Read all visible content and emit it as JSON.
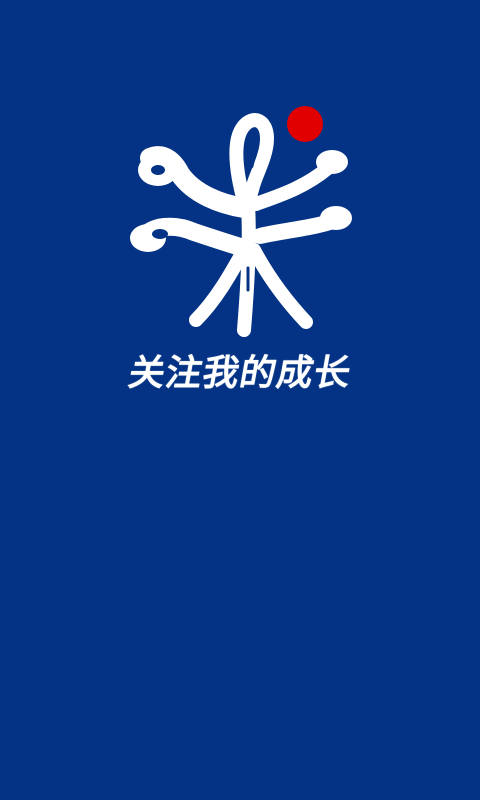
{
  "splash": {
    "slogan": "关注我的成长",
    "logo_icon": "rice-character-logo-icon",
    "colors": {
      "background": "#043385",
      "logo_stroke": "#ffffff",
      "accent_dot": "#e00000"
    }
  }
}
